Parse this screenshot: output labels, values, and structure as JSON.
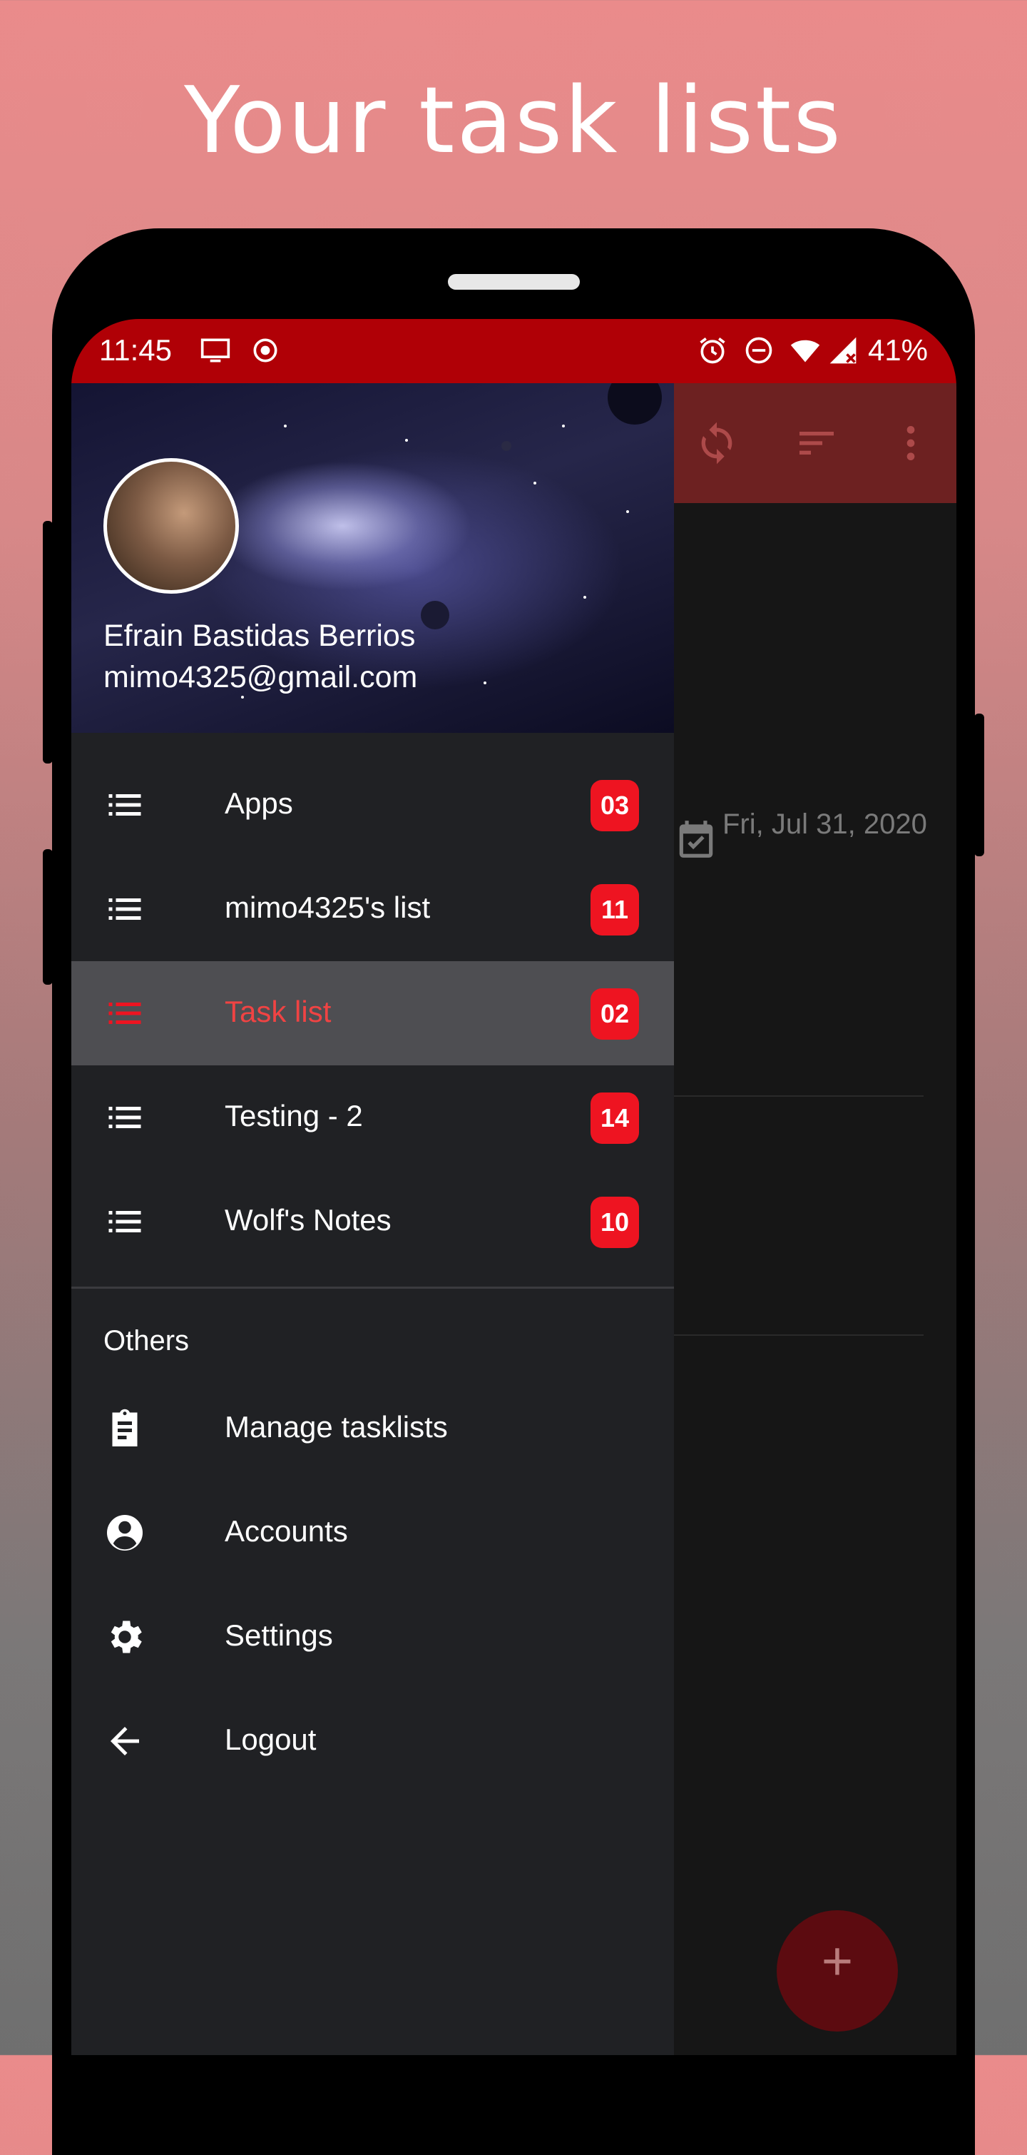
{
  "headline": "Your task lists",
  "status_bar": {
    "time": "11:45",
    "battery": "41%"
  },
  "colors": {
    "accent": "#ee1421",
    "status_bar": "#b00006",
    "drawer_bg": "#202124",
    "active_item_bg": "#4e4e52"
  },
  "drawer": {
    "user_name": "Efrain Bastidas Berrios",
    "user_email": "mimo4325@gmail.com",
    "lists": [
      {
        "label": "Apps",
        "count": "03",
        "active": false
      },
      {
        "label": "mimo4325's list",
        "count": "11",
        "active": false
      },
      {
        "label": "Task list",
        "count": "02",
        "active": true
      },
      {
        "label": "Testing - 2",
        "count": "14",
        "active": false
      },
      {
        "label": "Wolf's Notes",
        "count": "10",
        "active": false
      }
    ],
    "others_title": "Others",
    "others": [
      {
        "label": "Manage tasklists",
        "icon": "clipboard-icon"
      },
      {
        "label": "Accounts",
        "icon": "account-circle-icon"
      },
      {
        "label": "Settings",
        "icon": "gear-icon"
      },
      {
        "label": "Logout",
        "icon": "arrow-left-icon"
      }
    ]
  },
  "main_view": {
    "toolbar_icons": [
      "sync-icon",
      "sort-icon",
      "more-vert-icon"
    ],
    "due_date": "Fri, Jul 31, 2020"
  }
}
